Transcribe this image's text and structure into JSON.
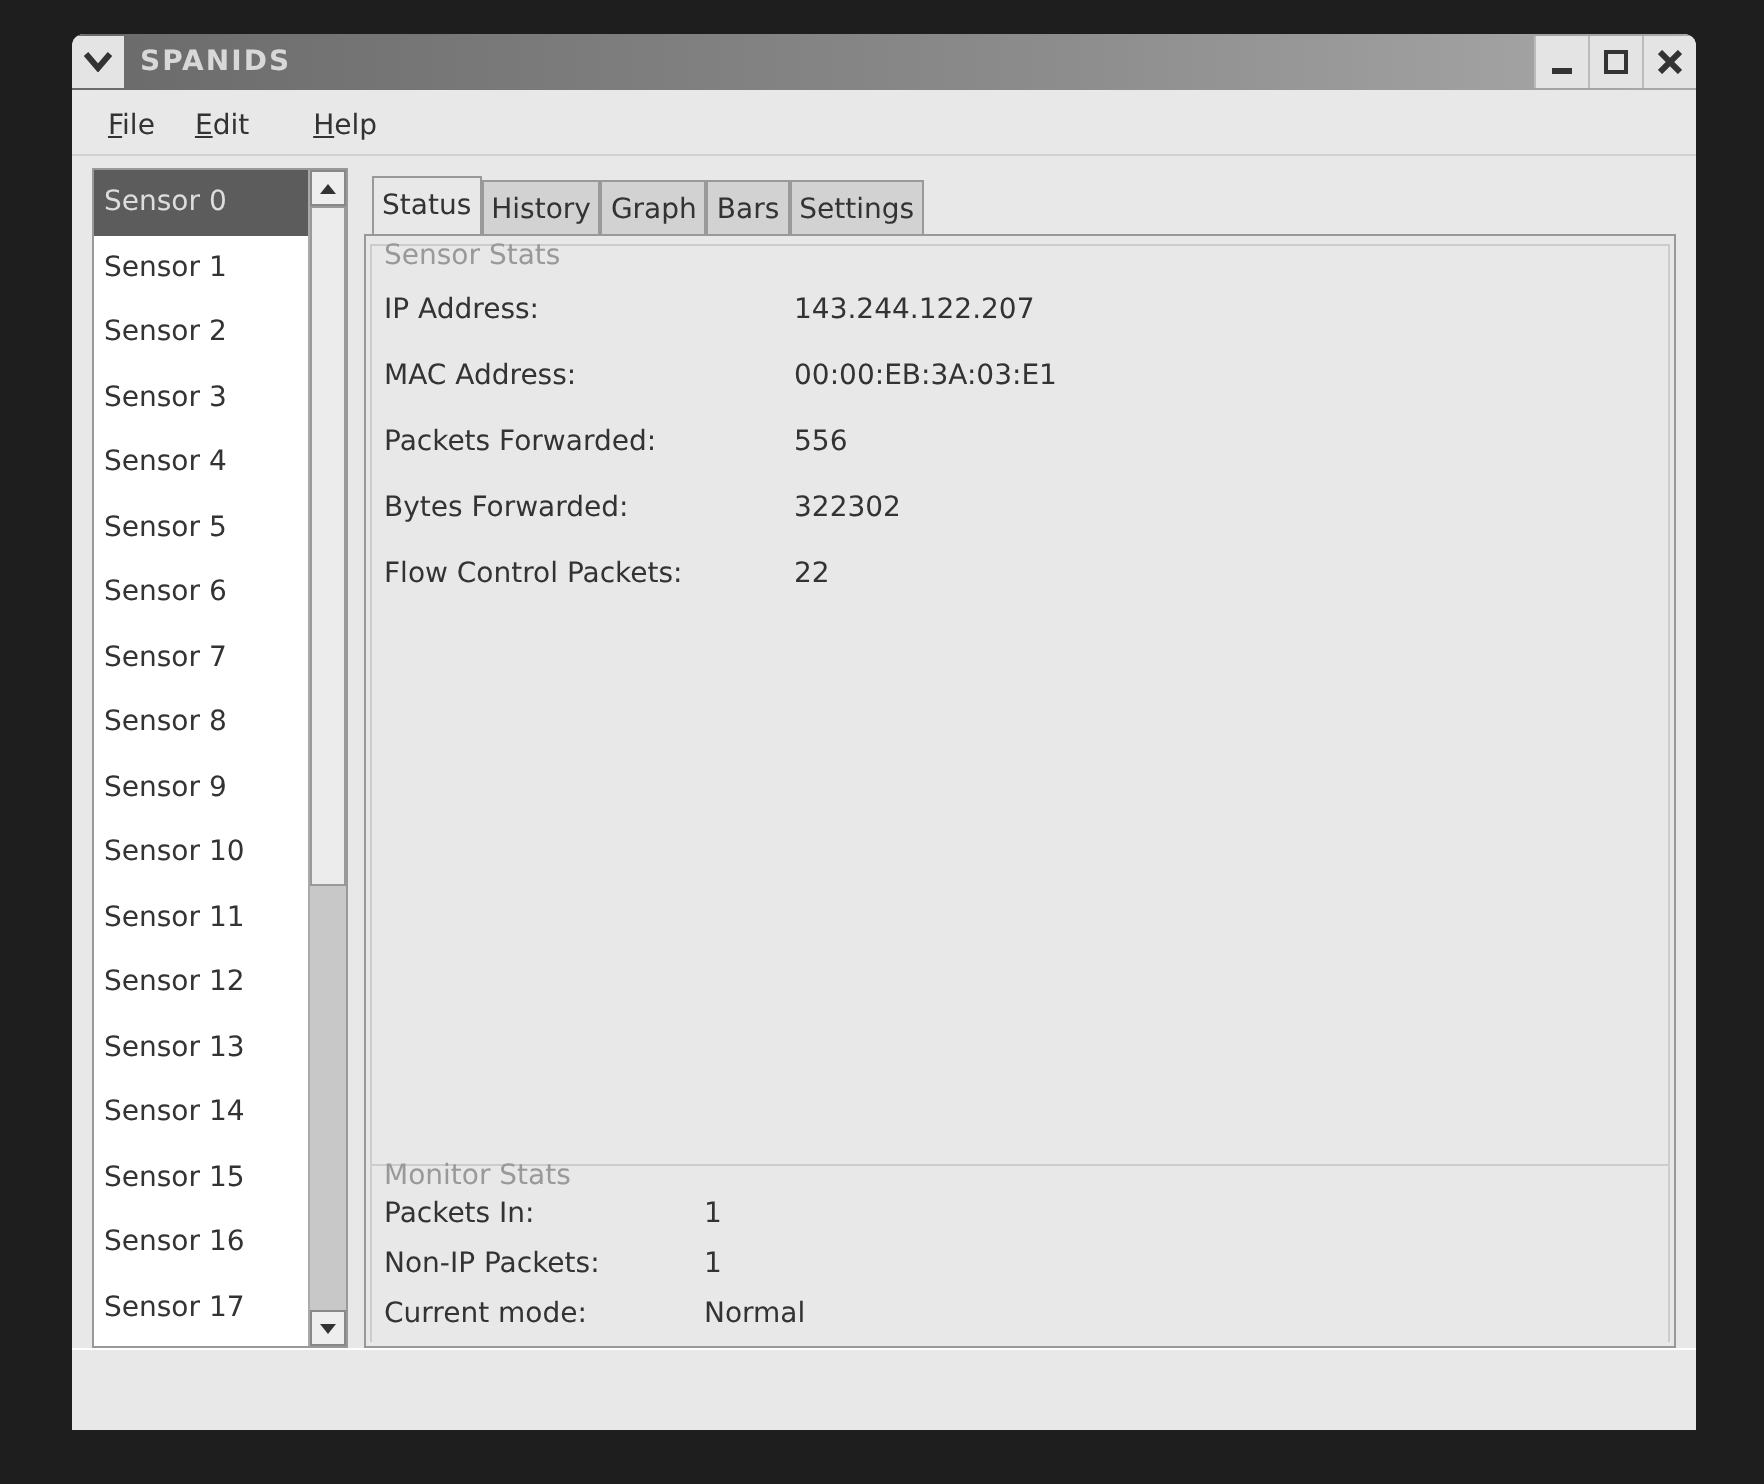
{
  "window": {
    "title": "SPANIDS"
  },
  "menu": [
    "File",
    "Edit",
    "Help"
  ],
  "sensors": [
    {
      "label": "Sensor 0",
      "selected": true
    },
    {
      "label": "Sensor 1",
      "selected": false
    },
    {
      "label": "Sensor 2",
      "selected": false
    },
    {
      "label": "Sensor 3",
      "selected": false
    },
    {
      "label": "Sensor 4",
      "selected": false
    },
    {
      "label": "Sensor 5",
      "selected": false
    },
    {
      "label": "Sensor 6",
      "selected": false
    },
    {
      "label": "Sensor 7",
      "selected": false
    },
    {
      "label": "Sensor 8",
      "selected": false
    },
    {
      "label": "Sensor 9",
      "selected": false
    },
    {
      "label": "Sensor 10",
      "selected": false
    },
    {
      "label": "Sensor 11",
      "selected": false
    },
    {
      "label": "Sensor 12",
      "selected": false
    },
    {
      "label": "Sensor 13",
      "selected": false
    },
    {
      "label": "Sensor 14",
      "selected": false
    },
    {
      "label": "Sensor 15",
      "selected": false
    },
    {
      "label": "Sensor 16",
      "selected": false
    },
    {
      "label": "Sensor 17",
      "selected": false
    }
  ],
  "tabs": [
    {
      "label": "Status",
      "selected": true
    },
    {
      "label": "History",
      "selected": false
    },
    {
      "label": "Graph",
      "selected": false
    },
    {
      "label": "Bars",
      "selected": false
    },
    {
      "label": "Settings",
      "selected": false
    }
  ],
  "sensor_stats": {
    "title": "Sensor Stats",
    "rows": [
      {
        "label": "IP Address:",
        "value": "143.244.122.207"
      },
      {
        "label": "MAC Address:",
        "value": "00:00:EB:3A:03:E1"
      },
      {
        "label": "Packets Forwarded:",
        "value": "556"
      },
      {
        "label": "Bytes Forwarded:",
        "value": "322302"
      },
      {
        "label": "Flow Control Packets:",
        "value": "22"
      }
    ]
  },
  "monitor_stats": {
    "title": "Monitor Stats",
    "rows": [
      {
        "label": "Packets In:",
        "value": "1"
      },
      {
        "label": "Non-IP Packets:",
        "value": "1"
      },
      {
        "label": "Current mode:",
        "value": "Normal"
      }
    ]
  }
}
